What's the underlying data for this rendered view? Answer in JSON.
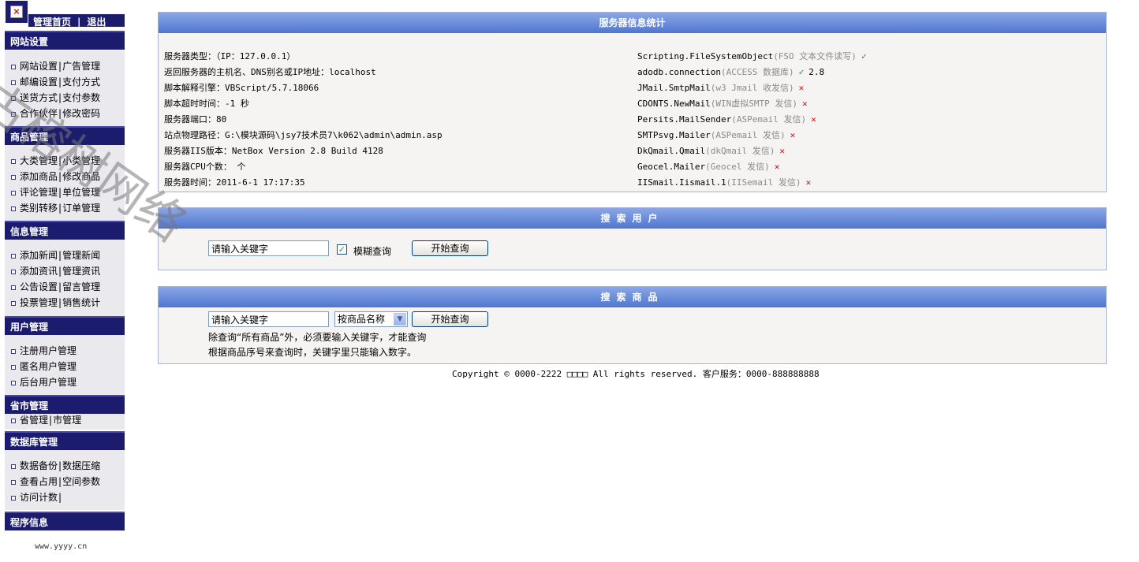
{
  "sidebar": {
    "top_links": {
      "home": "管理首页",
      "sep": "|",
      "logout": "退出"
    },
    "sections": [
      {
        "title": "网站设置",
        "rows": [
          [
            "网站设置",
            "广告管理"
          ],
          [
            "邮编设置",
            "支付方式"
          ],
          [
            "送货方式",
            "支付参数"
          ],
          [
            "合作伙伴",
            "修改密码"
          ]
        ]
      },
      {
        "title": "商品管理",
        "rows": [
          [
            "大类管理",
            "小类管理"
          ],
          [
            "添加商品",
            "修改商品"
          ],
          [
            "评论管理",
            "单位管理"
          ],
          [
            "类别转移",
            "订单管理"
          ]
        ]
      },
      {
        "title": "信息管理",
        "rows": [
          [
            "添加新闻",
            "管理新闻"
          ],
          [
            "添加资讯",
            "管理资讯"
          ],
          [
            "公告设置",
            "留言管理"
          ],
          [
            "投票管理",
            "销售统计"
          ]
        ]
      },
      {
        "title": "用户管理",
        "rows": [
          [
            "注册用户管理"
          ],
          [
            "匿名用户管理"
          ],
          [
            "后台用户管理"
          ]
        ]
      },
      {
        "title": "省市管理",
        "rows": [
          [
            "省管理",
            "市管理"
          ]
        ]
      },
      {
        "title": "数据库管理",
        "rows": [
          [
            "数据备份",
            "数据压缩"
          ],
          [
            "查看占用",
            "空间参数"
          ],
          [
            "访问计数",
            ""
          ]
        ]
      },
      {
        "title": "程序信息",
        "rows": []
      }
    ],
    "footer_url": "www.yyyy.cn"
  },
  "server_panel": {
    "title": "服务器信息统计",
    "left": [
      "服务器类型：（IP：127.0.0.1）",
      "返回服务器的主机名、DNS别名或IP地址：localhost",
      "脚本解释引擎：VBScript/5.7.18066",
      "脚本超时时间：-1 秒",
      "服务器端口：80",
      "站点物理路径：G:\\模块源码\\jsy7技术员7\\k062\\admin\\admin.asp",
      "服务器IIS版本：NetBox Version 2.8 Build 4128",
      "服务器CPU个数： 个",
      "服务器时间：2011-6-1 17:17:35"
    ],
    "right": [
      {
        "name": "Scripting.FileSystemObject",
        "note": "(FSO 文本文件读写)",
        "status": "ok",
        "extra": ""
      },
      {
        "name": "adodb.connection",
        "note": "(ACCESS 数据库)",
        "status": "ok",
        "extra": "2.8"
      },
      {
        "name": "JMail.SmtpMail",
        "note": "(w3 Jmail 收发信)",
        "status": "no",
        "extra": ""
      },
      {
        "name": "CDONTS.NewMail",
        "note": "(WIN虚拟SMTP 发信)",
        "status": "no",
        "extra": ""
      },
      {
        "name": "Persits.MailSender",
        "note": "(ASPemail 发信)",
        "status": "no",
        "extra": ""
      },
      {
        "name": "SMTPsvg.Mailer",
        "note": "(ASPemail 发信)",
        "status": "no",
        "extra": ""
      },
      {
        "name": "DkQmail.Qmail",
        "note": "(dkQmail 发信)",
        "status": "no",
        "extra": ""
      },
      {
        "name": "Geocel.Mailer",
        "note": "(Geocel 发信)",
        "status": "no",
        "extra": ""
      },
      {
        "name": "IISmail.Iismail.1",
        "note": "(IISemail 发信)",
        "status": "no",
        "extra": ""
      }
    ],
    "ok_mark": "✓",
    "no_mark": "✕"
  },
  "user_search": {
    "title": "搜索用户",
    "keyword_value": "请输入关键字",
    "fuzzy_label": "模糊查询",
    "fuzzy_checked": true,
    "button": "开始查询"
  },
  "product_search": {
    "title": "搜索商品",
    "keyword_value": "请输入关键字",
    "select_value": "按商品名称",
    "button": "开始查询",
    "note1": "除查询“所有商品”外，必须要输入关键字，才能查询",
    "note2": "根据商品序号来查询时，关键字里只能输入数字。"
  },
  "copyright": "Copyright © 0000-2222 □□□□ All rights reserved. 客户服务：0000-888888888",
  "watermark": "古榕树网络"
}
